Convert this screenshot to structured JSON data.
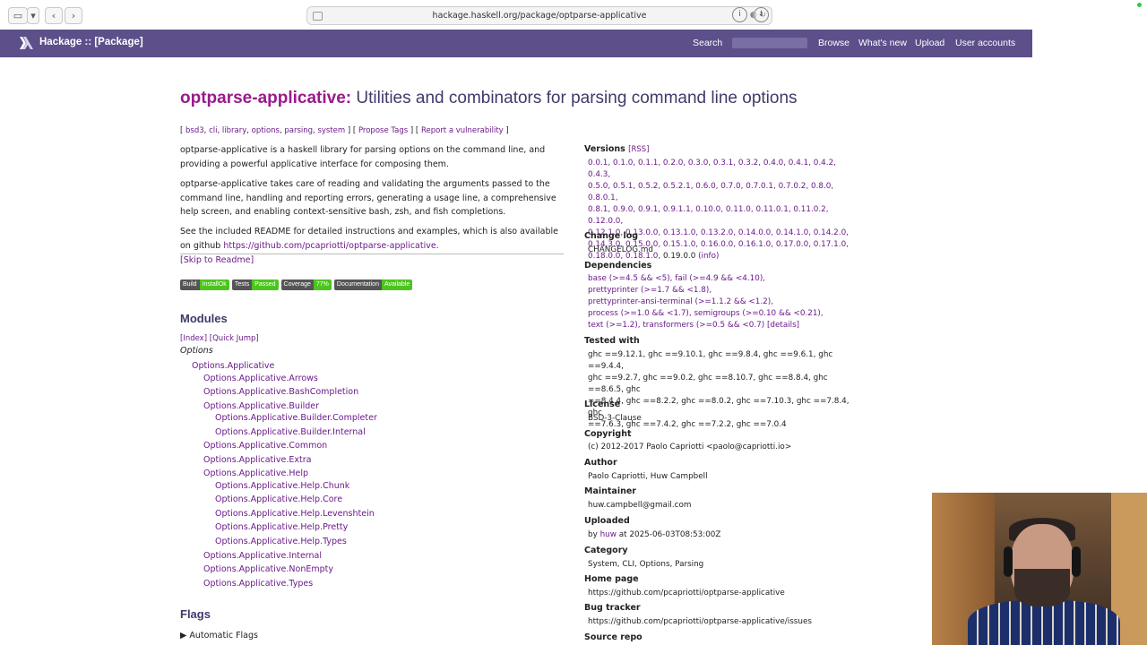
{
  "browser": {
    "url": "hackage.haskell.org/package/optparse-applicative"
  },
  "topbar": {
    "brand": "Hackage :: [Package]",
    "nav": [
      "Search",
      "Browse",
      "What's new",
      "Upload",
      "User accounts"
    ]
  },
  "package": {
    "name": "optparse-applicative:",
    "summary": "Utilities and combinators for parsing command line options",
    "tags": [
      "bsd3",
      "cli",
      "library",
      "options",
      "parsing",
      "system"
    ],
    "propose_tags": "Propose Tags",
    "report": "Report a vulnerability",
    "para1": "optparse-applicative is a haskell library for parsing options on the command line, and providing a powerful applicative interface for composing them.",
    "para2": "optparse-applicative takes care of reading and validating the arguments passed to the command line, handling and reporting errors, generating a usage line, a comprehensive help screen, and enabling context-sensitive bash, zsh, and fish completions.",
    "para3_text": "See the included README for detailed instructions and examples, which is also available on github ",
    "para3_link": "https://github.com/pcapriotti/optparse-applicative.",
    "skip": "[Skip to Readme]",
    "badges": [
      {
        "l": "Build",
        "r": "InstallOk"
      },
      {
        "l": "Tests",
        "r": "Passed"
      },
      {
        "l": "Coverage",
        "r": "77%"
      },
      {
        "l": "Documentation",
        "r": "Available"
      }
    ]
  },
  "modules": {
    "heading": "Modules",
    "index": "[Index]",
    "quick": "[Quick Jump]",
    "category": "Options",
    "items": [
      {
        "name": "Options.Applicative",
        "level": 1
      },
      {
        "name": "Options.Applicative.Arrows",
        "level": 2
      },
      {
        "name": "Options.Applicative.BashCompletion",
        "level": 2
      },
      {
        "name": "Options.Applicative.Builder",
        "level": 2
      },
      {
        "name": "Options.Applicative.Builder.Completer",
        "level": 3
      },
      {
        "name": "Options.Applicative.Builder.Internal",
        "level": 3
      },
      {
        "name": "Options.Applicative.Common",
        "level": 2
      },
      {
        "name": "Options.Applicative.Extra",
        "level": 2
      },
      {
        "name": "Options.Applicative.Help",
        "level": 2
      },
      {
        "name": "Options.Applicative.Help.Chunk",
        "level": 3
      },
      {
        "name": "Options.Applicative.Help.Core",
        "level": 3
      },
      {
        "name": "Options.Applicative.Help.Levenshtein",
        "level": 3
      },
      {
        "name": "Options.Applicative.Help.Pretty",
        "level": 3
      },
      {
        "name": "Options.Applicative.Help.Types",
        "level": 3
      },
      {
        "name": "Options.Applicative.Internal",
        "level": 2
      },
      {
        "name": "Options.Applicative.NonEmpty",
        "level": 2
      },
      {
        "name": "Options.Applicative.Types",
        "level": 2
      }
    ]
  },
  "flags": {
    "heading": "Flags",
    "automatic": "Automatic Flags"
  },
  "sidebar": {
    "versions_label": "Versions",
    "rss": "[RSS]",
    "versions_lines": [
      "0.0.1, 0.1.0, 0.1.1, 0.2.0, 0.3.0, 0.3.1, 0.3.2, 0.4.0, 0.4.1, 0.4.2, 0.4.3,",
      "0.5.0, 0.5.1, 0.5.2, 0.5.2.1, 0.6.0, 0.7.0, 0.7.0.1, 0.7.0.2, 0.8.0, 0.8.0.1,",
      "0.8.1, 0.9.0, 0.9.1, 0.9.1.1, 0.10.0, 0.11.0, 0.11.0.1, 0.11.0.2, 0.12.0.0,",
      "0.12.1.0, 0.13.0.0, 0.13.1.0, 0.13.2.0, 0.14.0.0, 0.14.1.0, 0.14.2.0,",
      "0.14.3.0, 0.15.0.0, 0.15.1.0, 0.16.0.0, 0.16.1.0, 0.17.0.0, 0.17.1.0,"
    ],
    "versions_last_links": "0.18.0.0, 0.18.1.0,",
    "versions_current": "0.19.0.0",
    "versions_info": "(info)",
    "changelog_label": "Change log",
    "changelog": "CHANGELOG.md",
    "deps_label": "Dependencies",
    "deps_lines": [
      "base (>=4.5 && <5), fail (>=4.9 && <4.10),",
      "prettyprinter (>=1.7 && <1.8),",
      "prettyprinter-ansi-terminal (>=1.1.2 && <1.2),",
      "process (>=1.0 && <1.7), semigroups (>=0.10 && <0.21),",
      "text (>=1.2), transformers (>=0.5 && <0.7) [details]"
    ],
    "tested_label": "Tested with",
    "tested_lines": [
      "ghc ==9.12.1, ghc ==9.10.1, ghc ==9.8.4, ghc ==9.6.1, ghc ==9.4.4,",
      "ghc ==9.2.7, ghc ==9.0.2, ghc ==8.10.7, ghc ==8.8.4, ghc ==8.6.5, ghc",
      "==8.4.4, ghc ==8.2.2, ghc ==8.0.2, ghc ==7.10.3, ghc ==7.8.4, ghc",
      "==7.6.3, ghc ==7.4.2, ghc ==7.2.2, ghc ==7.0.4"
    ],
    "license_label": "License",
    "license": "BSD-3-Clause",
    "copyright_label": "Copyright",
    "copyright": "(c) 2012-2017 Paolo Capriotti <paolo@capriotti.io>",
    "author_label": "Author",
    "author": "Paolo Capriotti, Huw Campbell",
    "maintainer_label": "Maintainer",
    "maintainer": "huw.campbell@gmail.com",
    "uploaded_label": "Uploaded",
    "uploaded_by": "by ",
    "uploaded_user": "huw",
    "uploaded_at": " at 2025-06-03T08:53:00Z",
    "category_label": "Category",
    "category": "System, CLI, Options, Parsing",
    "homepage_label": "Home page",
    "homepage": "https://github.com/pcapriotti/optparse-applicative",
    "bugtracker_label": "Bug tracker",
    "bugtracker": "https://github.com/pcapriotti/optparse-applicative/issues",
    "source_label": "Source repo"
  },
  "colors": {
    "topbar": "#5c4f8a",
    "link": "#6b1a8a",
    "title": "#3f3a6a",
    "badge_green": "#4bc51d"
  }
}
